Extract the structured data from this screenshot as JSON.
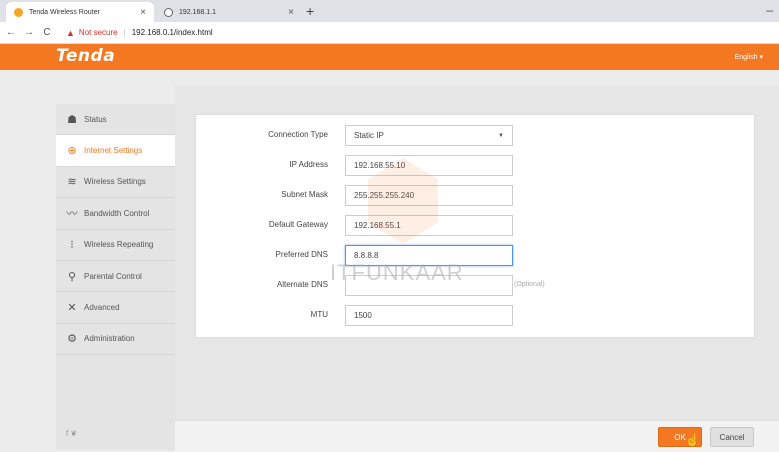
{
  "browser": {
    "tabs": [
      {
        "title": "Tenda Wireless Router",
        "active": true,
        "favicon_color": "#f5a623"
      },
      {
        "title": "192.168.1.1",
        "active": false,
        "favicon_color": "#5f6368"
      }
    ],
    "new_tab_glyph": "+",
    "minimize_glyph": "–",
    "close_glyph": "×",
    "nav": {
      "back": "←",
      "forward": "→",
      "reload": "C"
    },
    "security_warning": "Not secure",
    "separator": "|",
    "url": "192.168.0.1/index.html"
  },
  "header": {
    "logo": "Tenda",
    "language": "English ▾",
    "brand_color": "#f47721"
  },
  "sidebar": {
    "items": [
      {
        "label": "Status",
        "icon": "status-icon",
        "glyph": "☗",
        "active": false
      },
      {
        "label": "Internet Settings",
        "icon": "globe-icon",
        "glyph": "⊕",
        "active": true
      },
      {
        "label": "Wireless Settings",
        "icon": "wifi-icon",
        "glyph": "≋",
        "active": false
      },
      {
        "label": "Bandwidth Control",
        "icon": "bandwidth-icon",
        "glyph": "〰",
        "active": false
      },
      {
        "label": "Wireless Repeating",
        "icon": "repeater-icon",
        "glyph": "⁝",
        "active": false
      },
      {
        "label": "Parental Control",
        "icon": "parental-icon",
        "glyph": "⚲",
        "active": false
      },
      {
        "label": "Advanced",
        "icon": "tools-icon",
        "glyph": "✕",
        "active": false
      },
      {
        "label": "Administration",
        "icon": "gear-icon",
        "glyph": "⚙",
        "active": false
      }
    ],
    "social": "f ❦"
  },
  "form": {
    "connection_type": {
      "label": "Connection Type",
      "value": "Static IP",
      "caret": "▼"
    },
    "ip_address": {
      "label": "IP Address",
      "value": "192.168.55.10"
    },
    "subnet_mask": {
      "label": "Subnet Mask",
      "value": "255.255.255.240"
    },
    "default_gateway": {
      "label": "Default Gateway",
      "value": "192.168.55.1"
    },
    "preferred_dns": {
      "label": "Preferred DNS",
      "value": "8.8.8.8"
    },
    "alternate_dns": {
      "label": "Alternate DNS",
      "value": "",
      "hint": "(Optional)"
    },
    "mtu": {
      "label": "MTU",
      "value": "1500"
    }
  },
  "actions": {
    "ok": "OK",
    "cancel": "Cancel"
  },
  "watermark": "ITFUNKAAR"
}
